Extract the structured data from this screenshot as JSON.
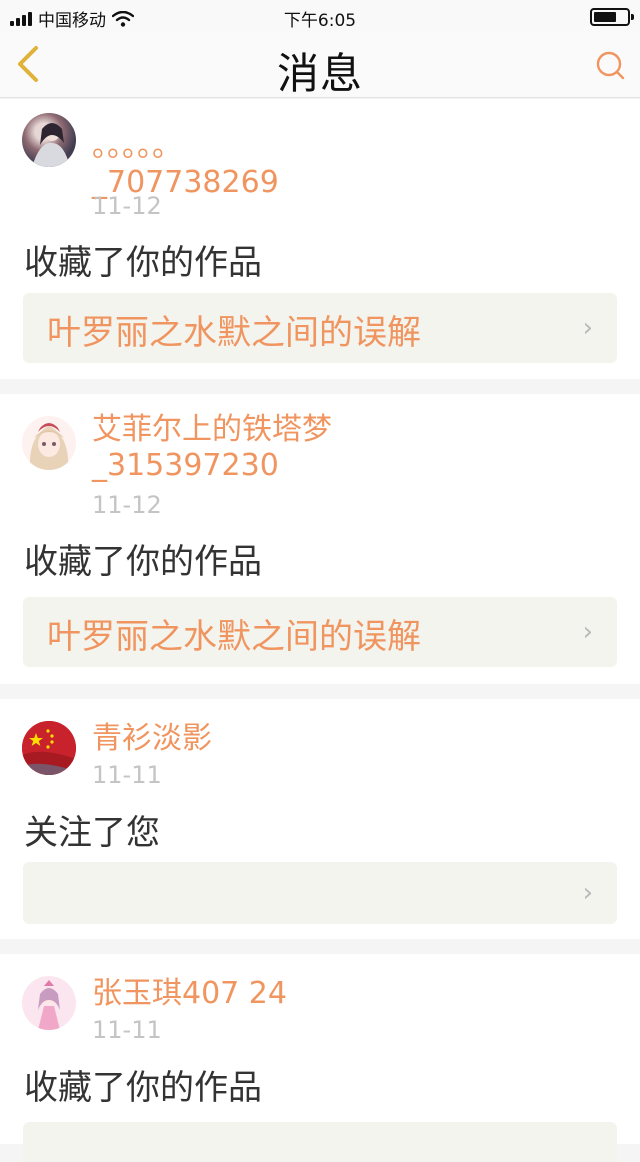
{
  "status_bar": {
    "carrier": "中国移动",
    "time": "下午6:05"
  },
  "nav": {
    "title": "消息"
  },
  "notifications": [
    {
      "user": "。。。。。\n_707738269",
      "date": "11-12",
      "action": "收藏了你的作品",
      "work": "叶罗丽之水默之间的误解"
    },
    {
      "user": "艾菲尔上的铁塔梦\n_315397230",
      "date": "11-12",
      "action": "收藏了你的作品",
      "work": "叶罗丽之水默之间的误解"
    },
    {
      "user": "青衫淡影",
      "date": "11-11",
      "action": "关注了您",
      "work": ""
    },
    {
      "user": "张玉琪407 24",
      "date": "11-11",
      "action": "收藏了你的作品",
      "work": ""
    }
  ],
  "colors": {
    "accent": "#f0955f",
    "date": "#c4c4c4",
    "work_bg": "#f4f4ef"
  }
}
